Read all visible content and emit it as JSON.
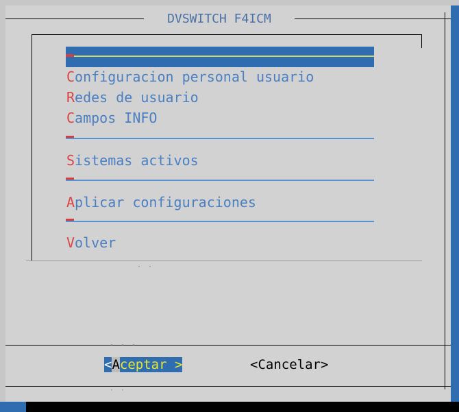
{
  "dialog": {
    "title": "DVSWITCH F4ICM"
  },
  "menu": {
    "items": [
      {
        "hot": "C",
        "rest": "onfiguracion personal usuario"
      },
      {
        "hot": "R",
        "rest": "edes de usuario"
      },
      {
        "hot": "C",
        "rest": "ampos INFO"
      },
      {
        "hot": "S",
        "rest": "istemas activos"
      },
      {
        "hot": "A",
        "rest": "plicar configuraciones"
      },
      {
        "hot": "V",
        "rest": "olver"
      }
    ]
  },
  "buttons": {
    "ok": {
      "lt": "<",
      "hot": "A",
      "rest": "ceptar >"
    },
    "cancel": "<Cancelar>"
  },
  "colors": {
    "background": "#d2d2d2",
    "accent_blue": "#2f6db0",
    "item_text": "#4a7fc1",
    "hotkey_red": "#d94545",
    "selected_text": "#e8e830"
  }
}
